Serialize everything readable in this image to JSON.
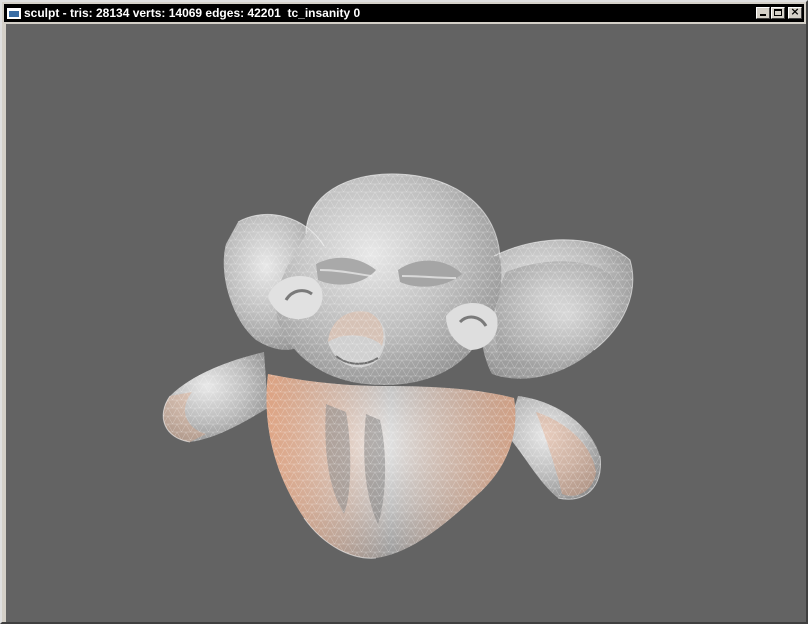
{
  "window": {
    "title": "sculpt - tris: 28134 verts: 14069 edges: 42201  tc_insanity 0",
    "icons": {
      "app": "window-app-icon",
      "minimize": "minimize-icon",
      "maximize": "maximize-icon",
      "close": "close-icon"
    },
    "close_glyph": "×"
  },
  "viewport": {
    "background": "#636363",
    "mesh_base_color": "#cfcfcf",
    "mesh_highlight_color": "#e6a27c",
    "wire_color": "#ffffff",
    "subject": "sculpted monkey head mesh"
  }
}
